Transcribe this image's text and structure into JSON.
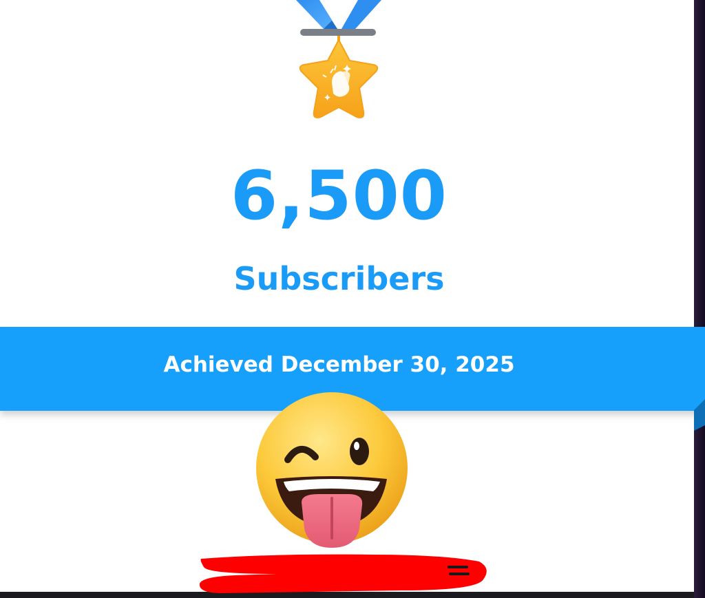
{
  "milestone": {
    "count": "6,500",
    "label": "Subscribers",
    "achieved": "Achieved December 30, 2025"
  },
  "icons": {
    "medal": "medal-star-clapping-hands-icon",
    "overlay_emoji": "winking-face-with-tongue-emoji"
  },
  "colors": {
    "accent": "#16a0fb",
    "medal_gold": "#fbb324",
    "ribbon_strap": "#2f8ff0",
    "redaction": "#ff0000"
  }
}
